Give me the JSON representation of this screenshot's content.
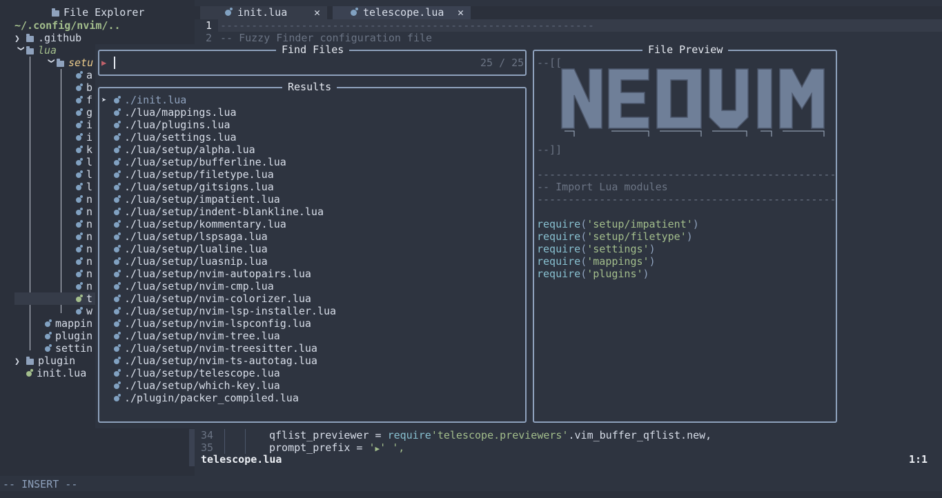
{
  "explorer": {
    "title": "File Explorer",
    "root": "~/.config/nvim/..",
    "rows": [
      {
        "label": ".github"
      },
      {
        "label": "lua"
      },
      {
        "label": "setu"
      },
      {
        "label": "a"
      },
      {
        "label": "b"
      },
      {
        "label": "f"
      },
      {
        "label": "g"
      },
      {
        "label": "i"
      },
      {
        "label": "i"
      },
      {
        "label": "k"
      },
      {
        "label": "l"
      },
      {
        "label": "l"
      },
      {
        "label": "l"
      },
      {
        "label": "n"
      },
      {
        "label": "n"
      },
      {
        "label": "n"
      },
      {
        "label": "n"
      },
      {
        "label": "n"
      },
      {
        "label": "n"
      },
      {
        "label": "n"
      },
      {
        "label": "n"
      },
      {
        "label": "t"
      },
      {
        "label": "w"
      },
      {
        "label": "mappin"
      },
      {
        "label": "plugin"
      },
      {
        "label": "settin"
      },
      {
        "label": "plugin"
      },
      {
        "label": "init.lua"
      }
    ]
  },
  "tabs": [
    {
      "label": "init.lua"
    },
    {
      "label": "telescope.lua"
    }
  ],
  "editor": {
    "line1_no": "1",
    "line1": "------------------------------------------------------------",
    "line2_no": "2",
    "line2": "-- Fuzzy Finder configuration file",
    "line34_no": "34",
    "line34_a": "qflist_previewer = ",
    "line34_b": "require",
    "line34_c": "'telescope.previewers'",
    "line34_d": ".vim_buffer_qflist.new,",
    "line35_no": "35",
    "line35_a": "prompt_prefix = ",
    "line35_b": "' ',"
  },
  "telescope": {
    "prompt_title": "Find Files",
    "prompt_counter": "25 / 25",
    "results_title": "Results",
    "preview_title": "File Preview",
    "results": [
      "./init.lua",
      "./lua/mappings.lua",
      "./lua/plugins.lua",
      "./lua/settings.lua",
      "./lua/setup/alpha.lua",
      "./lua/setup/bufferline.lua",
      "./lua/setup/filetype.lua",
      "./lua/setup/gitsigns.lua",
      "./lua/setup/impatient.lua",
      "./lua/setup/indent-blankline.lua",
      "./lua/setup/kommentary.lua",
      "./lua/setup/lspsaga.lua",
      "./lua/setup/lualine.lua",
      "./lua/setup/luasnip.lua",
      "./lua/setup/nvim-autopairs.lua",
      "./lua/setup/nvim-cmp.lua",
      "./lua/setup/nvim-colorizer.lua",
      "./lua/setup/nvim-lsp-installer.lua",
      "./lua/setup/nvim-lspconfig.lua",
      "./lua/setup/nvim-tree.lua",
      "./lua/setup/nvim-treesitter.lua",
      "./lua/setup/nvim-ts-autotag.lua",
      "./lua/setup/telescope.lua",
      "./lua/setup/which-key.lua",
      "./plugin/packer_compiled.lua"
    ],
    "preview": {
      "open_comment": "--[[",
      "close_comment": "--]]",
      "rule": "------------------------------------------------------------",
      "import_comment": "-- Import Lua modules",
      "require_fn": "require",
      "requires": [
        "'setup/impatient'",
        "'setup/filetype'",
        "'settings'",
        "'mappings'",
        "'plugins'"
      ],
      "open_paren": "(",
      "close_paren": ")"
    }
  },
  "statusline": {
    "file": "telescope.lua",
    "position": "1:1"
  },
  "mode": "-- INSERT --",
  "colors": {
    "background": "#2e3440",
    "accent": "#8fa2bd",
    "string": "#a3be8c",
    "function": "#88c0d0",
    "lua_icon": "#81a1c1"
  }
}
